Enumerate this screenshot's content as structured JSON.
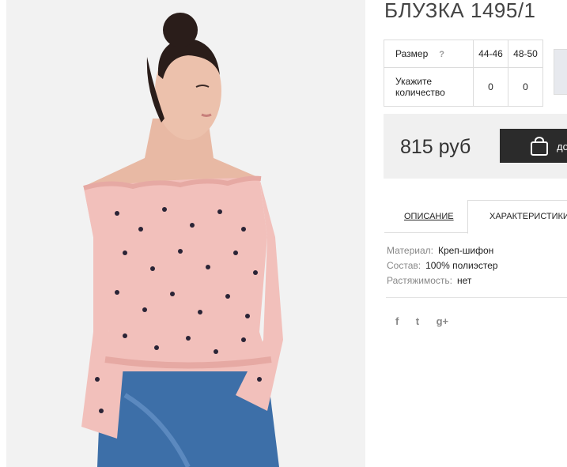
{
  "product": {
    "title": "БЛУЗКА 1495/1",
    "image_alt": "woman-in-pink-blouse"
  },
  "size_table": {
    "size_label": "Размер",
    "help": "?",
    "sizes": [
      "44-46",
      "48-50"
    ],
    "qty_label_line1": "Укажите",
    "qty_label_line2": "количество",
    "quantities": [
      "0",
      "0"
    ]
  },
  "purchase": {
    "price": "815 руб",
    "cart_button_label": "до"
  },
  "tabs": {
    "description": "ОПИСАНИЕ",
    "characteristics": "ХАРАКТЕРИСТИКИ"
  },
  "specs": [
    {
      "key": "Материал:",
      "value": "Креп-шифон"
    },
    {
      "key": "Состав:",
      "value": "100% полиэстер"
    },
    {
      "key": "Растяжимость:",
      "value": "нет"
    }
  ],
  "social": {
    "facebook": "f",
    "twitter": "t",
    "google": "g+"
  },
  "colors": {
    "blouse": "#f2c0bb",
    "button": "#2b2b2b",
    "price_bg": "#f0f0f0"
  }
}
